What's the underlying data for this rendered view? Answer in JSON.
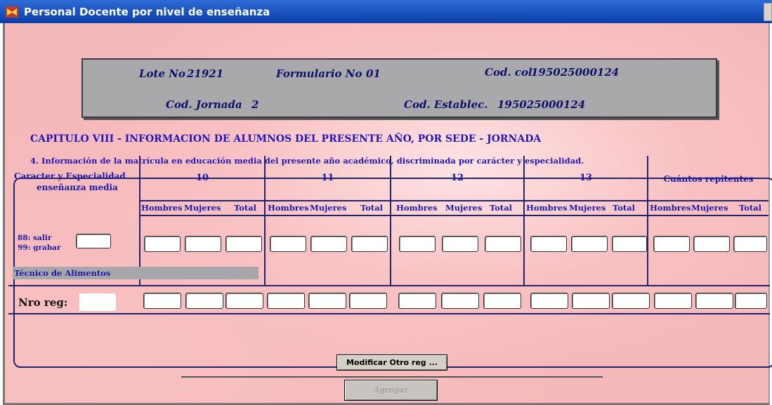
{
  "window": {
    "title": "Personal Docente por nivel de enseñanza"
  },
  "header": {
    "lote_label": "Lote No",
    "lote_value": "21921",
    "formulario_label": "Formulario No",
    "formulario_value": "01",
    "cod_col_label": "Cod. col",
    "cod_col_value": "195025000124",
    "cod_jornada_label": "Cod. Jornada",
    "cod_jornada_value": "2",
    "cod_establec_label": "Cod. Establec.",
    "cod_establec_value": "195025000124"
  },
  "chapter": {
    "title": "CAPITULO VIII - INFORMACION DE ALUMNOS DEL PRESENTE AÑO, POR SEDE - JORNADA",
    "subtitle": "4. Información de la matrícula en educación media del presente año académico, discriminada por carácter y especialidad."
  },
  "table": {
    "first_col_header_line1": "Caracter y Especialidad",
    "first_col_header_line2": "enseñanza media",
    "groups": [
      {
        "label": "10",
        "sub": [
          "Hombres",
          "Mujeres",
          "Total"
        ]
      },
      {
        "label": "11",
        "sub": [
          "Hombres",
          "Mujeres",
          "Total"
        ]
      },
      {
        "label": "12",
        "sub": [
          "Hombres",
          "Mujeres",
          "Total"
        ]
      },
      {
        "label": "13",
        "sub": [
          "Hombres",
          "Mujeres",
          "Total"
        ]
      },
      {
        "label": "Cuántos repitentes",
        "sub": [
          "Hombres",
          "Mujeres",
          "Total"
        ]
      }
    ],
    "hint_salir": "88: salir",
    "hint_grabar": "99: grabar",
    "especialidad": "Técnico de Alimentos",
    "nro_reg_label": "Nro reg:"
  },
  "buttons": {
    "modificar": "Modificar Otro reg ...",
    "agregar": "Agregar"
  },
  "colors": {
    "background": "#f6b9bb",
    "accent": "#1a1aa8",
    "frame": "#23236b",
    "titlebar": "#0a3ea8"
  }
}
